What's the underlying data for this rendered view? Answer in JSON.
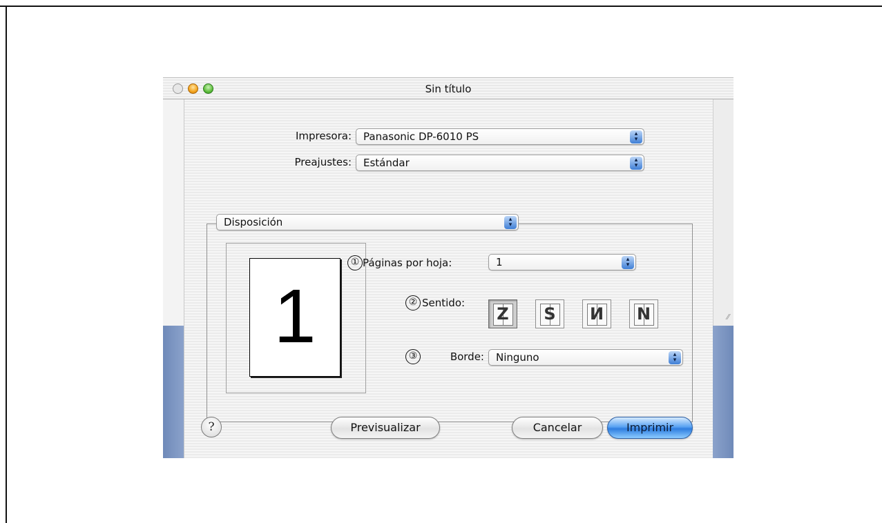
{
  "window": {
    "title": "Sin título"
  },
  "form": {
    "printer_label": "Impresora:",
    "printer_value": "Panasonic DP-6010 PS",
    "presets_label": "Preajustes:",
    "presets_value": "Estándar",
    "section_value": "Disposición"
  },
  "layout": {
    "preview_page_number": "1",
    "pages_per_sheet_label": "Páginas por hoja:",
    "pages_per_sheet_value": "1",
    "direction_label": "Sentido:",
    "border_label": "Borde:",
    "border_value": "Ninguno",
    "callouts": [
      "①",
      "②",
      "③"
    ],
    "directions": [
      {
        "icon": "z-direction-icon",
        "glyph": "Z",
        "selected": true
      },
      {
        "icon": "reverse-z-direction-icon",
        "glyph": "S",
        "selected": false
      },
      {
        "icon": "n-direction-icon",
        "glyph": "И",
        "selected": false
      },
      {
        "icon": "reverse-n-direction-icon",
        "glyph": "N",
        "selected": false
      }
    ]
  },
  "buttons": {
    "help": "?",
    "preview": "Previsualizar",
    "cancel": "Cancelar",
    "print": "Imprimir"
  },
  "colors": {
    "accent_blue": "#3f7fd6",
    "desktop_blue": "#7f98c4"
  }
}
